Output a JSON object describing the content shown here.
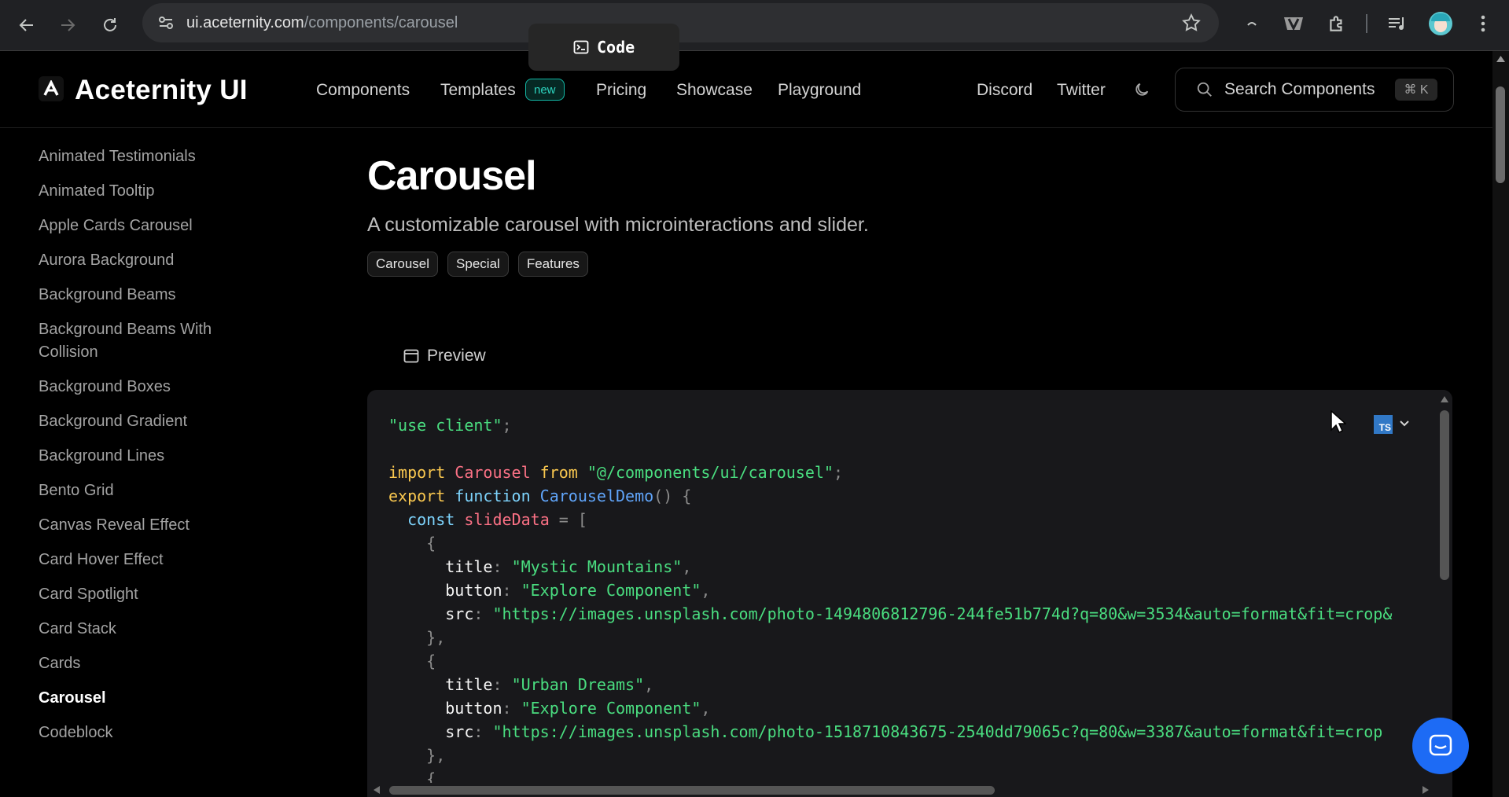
{
  "browser": {
    "url_host": "ui.aceternity.com",
    "url_path": "/components/carousel"
  },
  "header": {
    "brand": "Aceternity UI",
    "nav": [
      "Components",
      "Templates",
      "Pricing",
      "Showcase",
      "Playground"
    ],
    "new_badge": "new",
    "links": [
      "Discord",
      "Twitter"
    ],
    "search_label": "Search Components",
    "search_shortcut": "⌘ K"
  },
  "sidebar": {
    "items": [
      "Animated Testimonials",
      "Animated Tooltip",
      "Apple Cards Carousel",
      "Aurora Background",
      "Background Beams",
      "Background Beams With Collision",
      "Background Boxes",
      "Background Gradient",
      "Background Lines",
      "Bento Grid",
      "Canvas Reveal Effect",
      "Card Hover Effect",
      "Card Spotlight",
      "Card Stack",
      "Cards",
      "Carousel",
      "Codeblock"
    ],
    "active": "Carousel"
  },
  "page": {
    "title": "Carousel",
    "subtitle": "A customizable carousel with microinteractions and slider.",
    "tags": [
      "Carousel",
      "Special",
      "Features"
    ],
    "tabs": [
      "Preview",
      "Code"
    ],
    "active_tab": "Code",
    "language_badge": "TS"
  },
  "code": {
    "use_client": "\"use client\"",
    "import_kw": "import",
    "component": "Carousel",
    "from_kw": "from",
    "module": "\"@/components/ui/carousel\"",
    "export_kw": "export",
    "function_kw": "function",
    "fn_name": "CarouselDemo",
    "const_kw": "const",
    "var_name": "slideData",
    "slides": [
      {
        "title": "\"Mystic Mountains\"",
        "button": "\"Explore Component\"",
        "src": "\"https://images.unsplash.com/photo-1494806812796-244fe51b774d?q=80&w=3534&auto=format&fit=crop&"
      },
      {
        "title": "\"Urban Dreams\"",
        "button": "\"Explore Component\"",
        "src": "\"https://images.unsplash.com/photo-1518710843675-2540dd79065c?q=80&w=3387&auto=format&fit=crop"
      }
    ]
  }
}
